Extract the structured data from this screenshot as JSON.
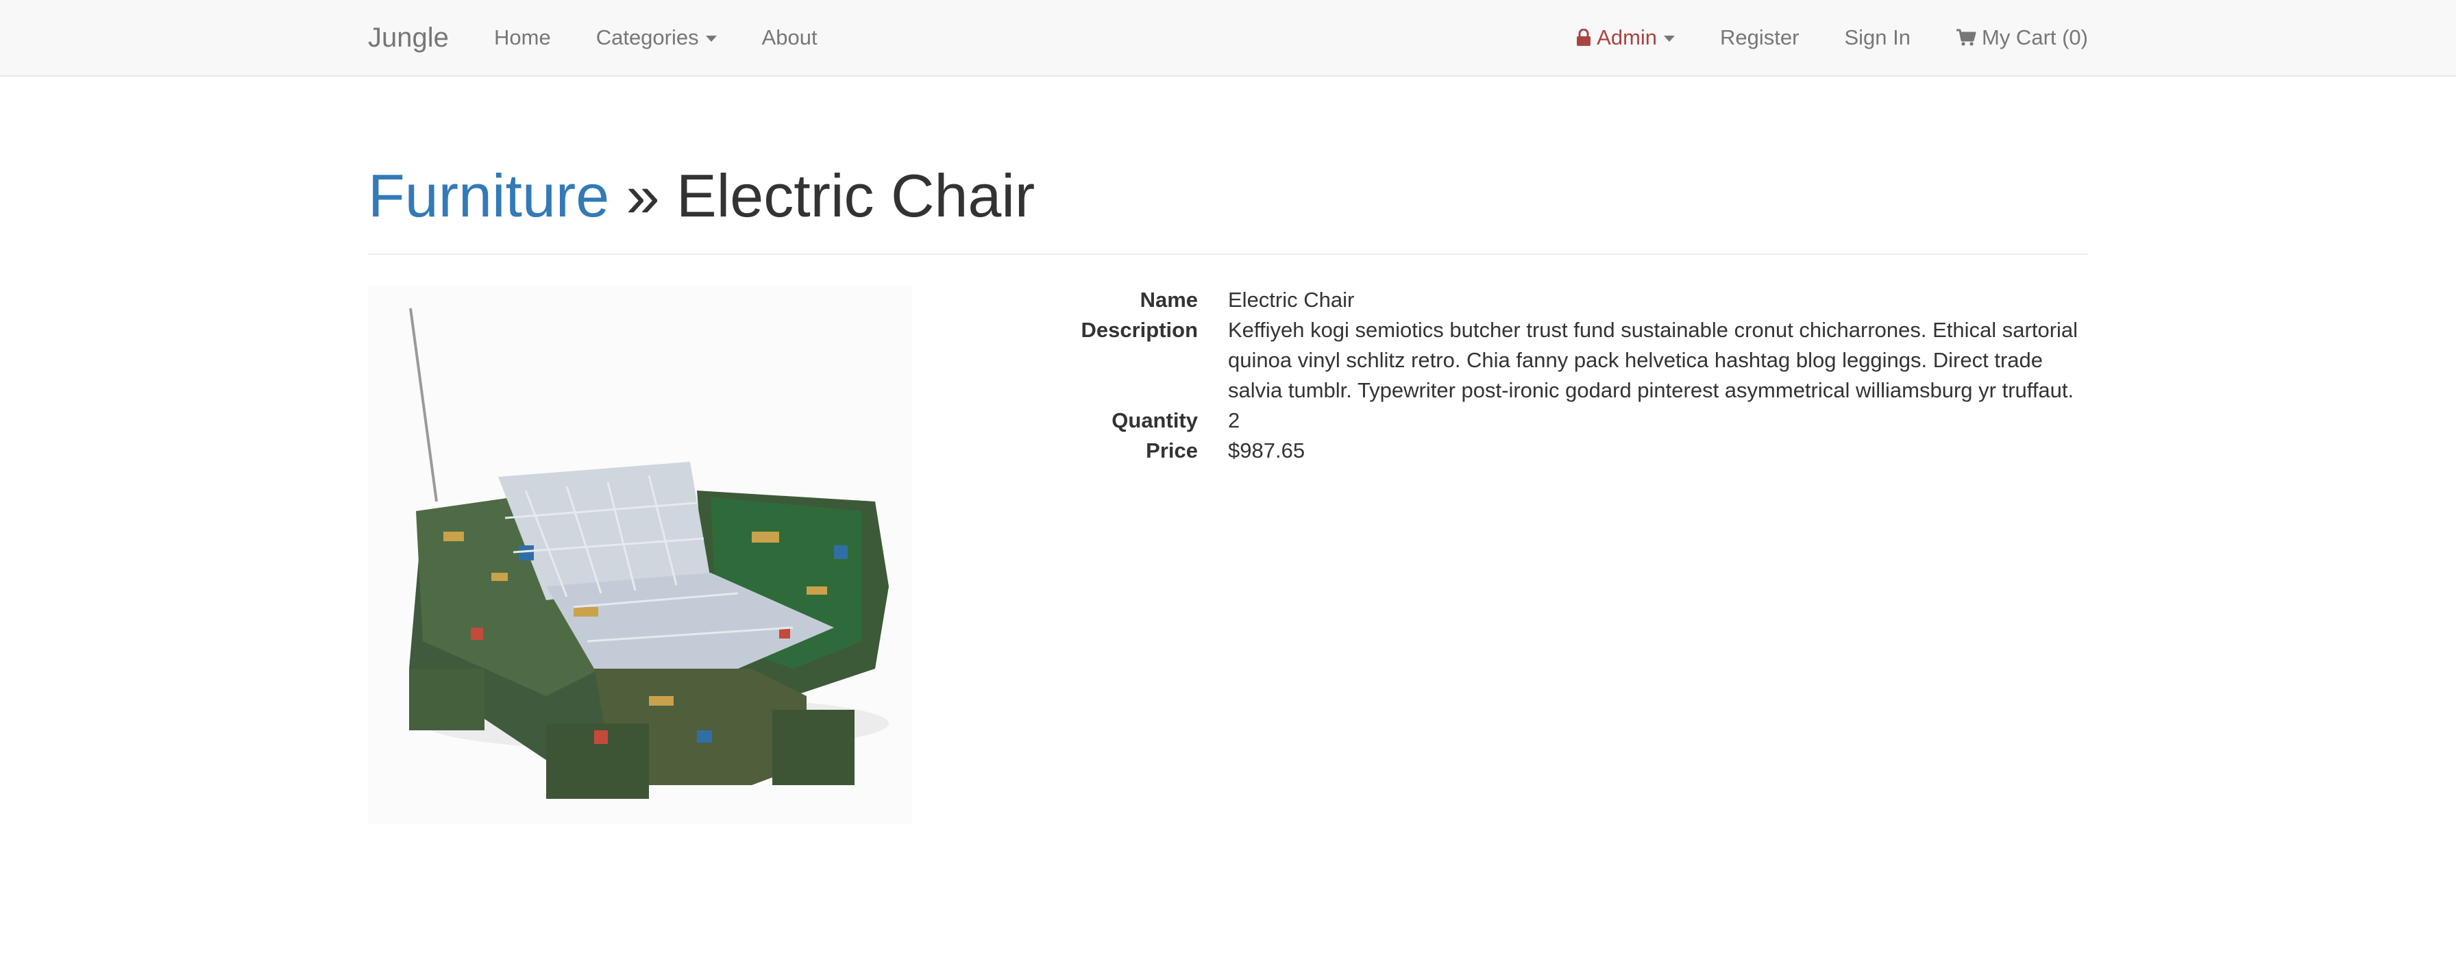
{
  "navbar": {
    "brand": "Jungle",
    "left_items": {
      "home": "Home",
      "categories": "Categories",
      "about": "About"
    },
    "right_items": {
      "admin": "Admin",
      "register": "Register",
      "sign_in": "Sign In",
      "cart": "My Cart (0)"
    },
    "icons": {
      "admin": "lock-icon",
      "cart": "shopping-cart-icon",
      "dropdown": "caret-down-icon"
    },
    "colors": {
      "background": "#f8f8f8",
      "link": "#777777",
      "admin": "#a94442"
    }
  },
  "header": {
    "category": "Furniture",
    "separator": "»",
    "product_name": "Electric Chair",
    "category_color": "#337ab7"
  },
  "product": {
    "image_alt": "Electric Chair",
    "image_description_icon": "chair-made-of-circuit-boards-image",
    "fields": {
      "name_label": "Name",
      "name_value": "Electric Chair",
      "description_label": "Description",
      "description_value": "Keffiyeh kogi semiotics butcher trust fund sustainable cronut chicharrones. Ethical sartorial quinoa vinyl schlitz retro. Chia fanny pack helvetica hashtag blog leggings. Direct trade salvia tumblr. Typewriter post-ironic godard pinterest asymmetrical williamsburg yr truffaut.",
      "quantity_label": "Quantity",
      "quantity_value": "2",
      "price_label": "Price",
      "price_value": "$987.65"
    }
  }
}
